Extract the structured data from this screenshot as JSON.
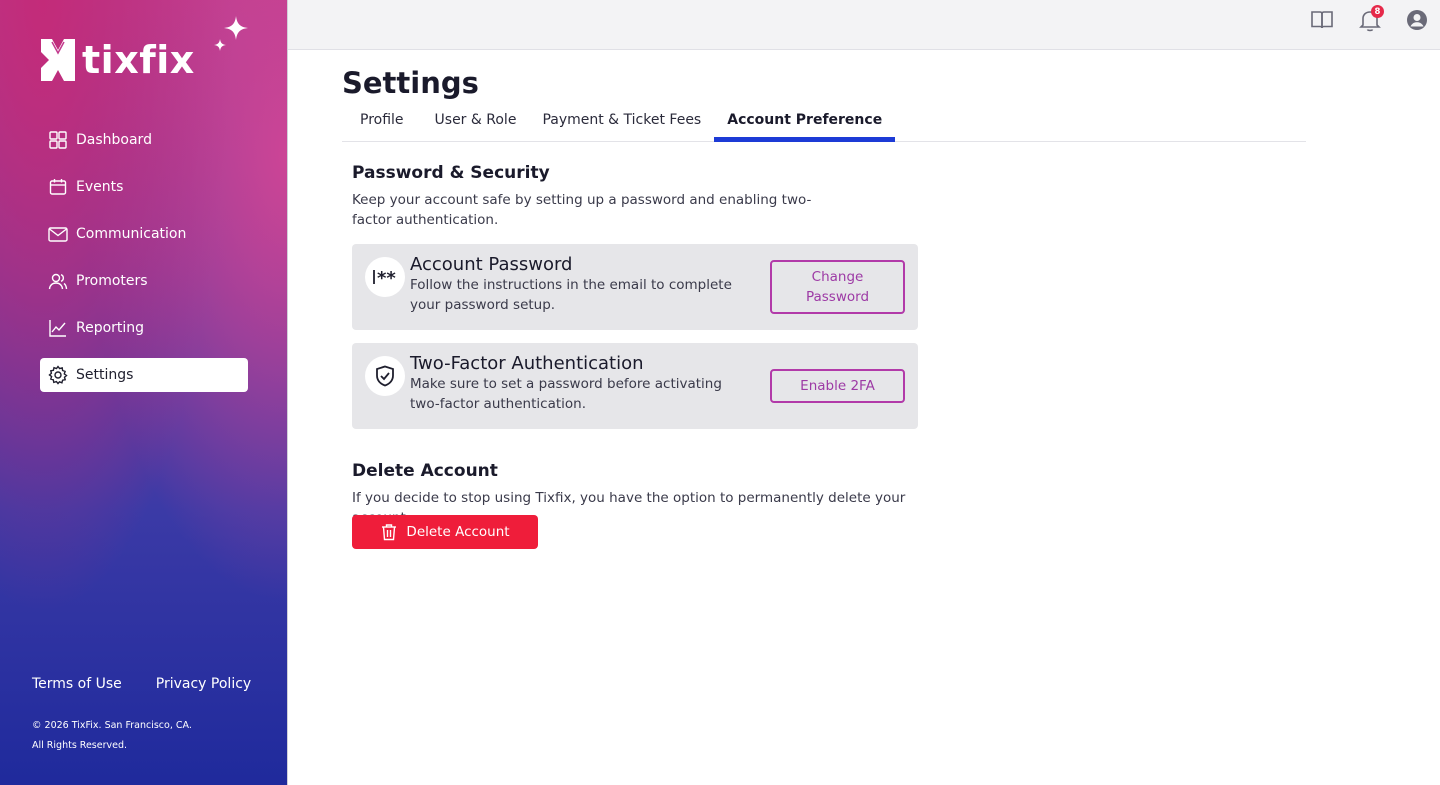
{
  "brand": {
    "name": "tixfix"
  },
  "sidebar": {
    "items": [
      {
        "label": "Dashboard",
        "icon": "dashboard-icon"
      },
      {
        "label": "Events",
        "icon": "calendar-icon"
      },
      {
        "label": "Communication",
        "icon": "mail-icon"
      },
      {
        "label": "Promoters",
        "icon": "users-icon"
      },
      {
        "label": "Reporting",
        "icon": "chart-icon"
      },
      {
        "label": "Settings",
        "icon": "gear-icon",
        "active": true
      }
    ],
    "footer": {
      "terms": "Terms of Use",
      "privacy": "Privacy Policy",
      "copyright_line1": "© 2026 TixFix. San Francisco, CA.",
      "copyright_line2": "All Rights Reserved."
    }
  },
  "topbar": {
    "icons": [
      "book-icon",
      "bell-icon",
      "user-icon"
    ],
    "notification_count": "8"
  },
  "page": {
    "title": "Settings",
    "tabs": [
      {
        "label": "Profile"
      },
      {
        "label": "User & Role"
      },
      {
        "label": "Payment & Ticket Fees"
      },
      {
        "label": "Account Preference",
        "active": true
      }
    ]
  },
  "security": {
    "title": "Password & Security",
    "description": "Keep your account safe by setting up a password and enabling two-factor authentication.",
    "password_card": {
      "title": "Account Password",
      "description": "Follow the instructions in the email to complete your password setup.",
      "button": "Change Password"
    },
    "twofa_card": {
      "title": "Two-Factor Authentication",
      "description": "Make sure to set a password before activating two-factor authentication.",
      "button": "Enable 2FA"
    }
  },
  "delete": {
    "title": "Delete Account",
    "description": "If you decide to stop using Tixfix, you have the option to permanently delete your account.",
    "button": "Delete Account"
  },
  "colors": {
    "accent": "#1d3bd6",
    "danger": "#ef1d3a",
    "outline": "#b23aa9"
  }
}
